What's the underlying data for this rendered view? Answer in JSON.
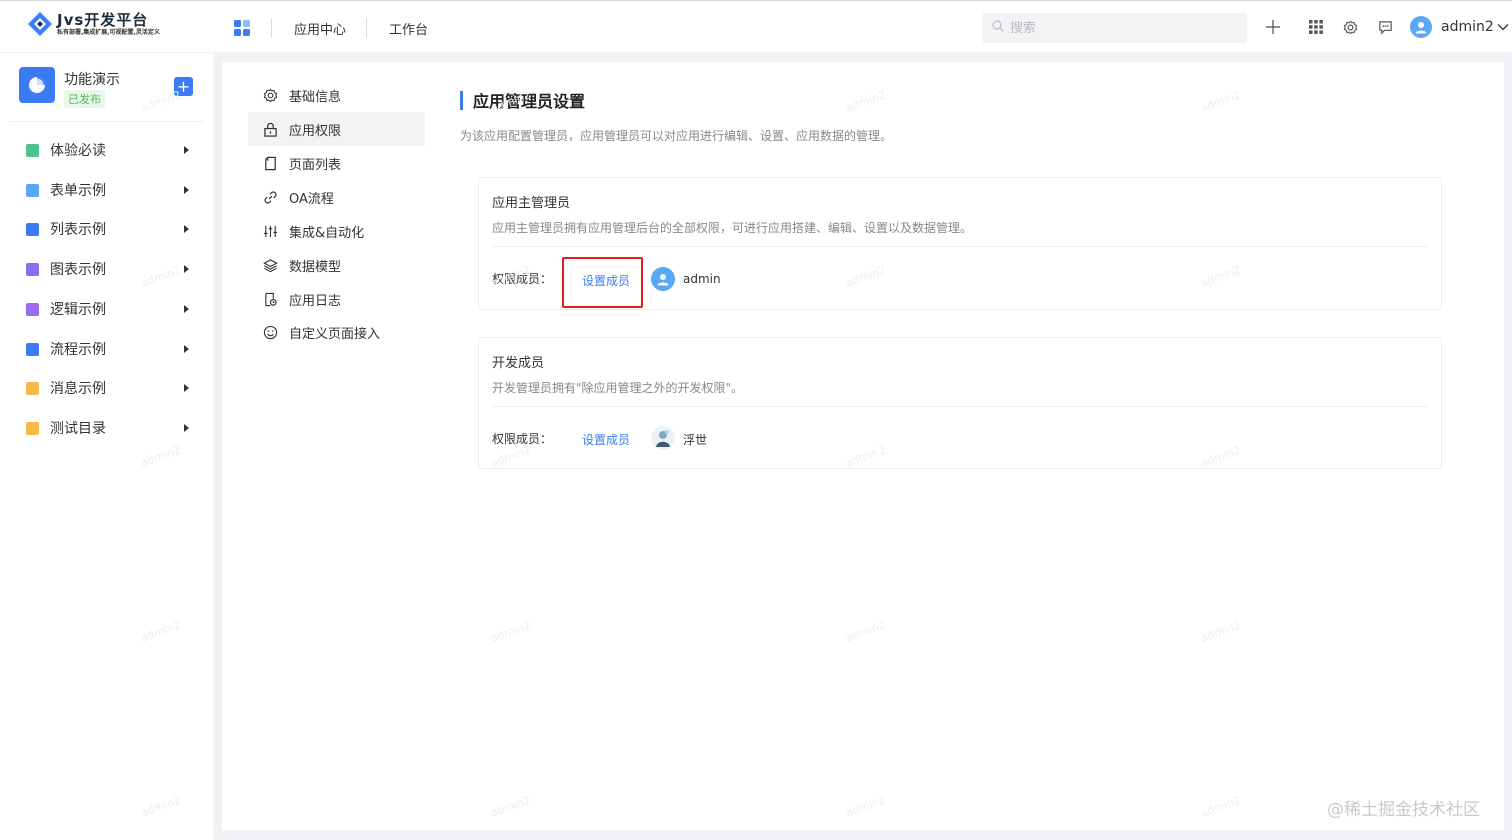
{
  "header": {
    "logo_title": "Jvs开发平台",
    "logo_subtitle": "私有部署,集成扩展,可视配置,灵活定义",
    "nav": [
      "应用中心",
      "工作台"
    ],
    "search_placeholder": "搜索",
    "username": "admin2"
  },
  "sidebar": {
    "app_name": "功能演示",
    "app_status": "已发布",
    "add_label": "+",
    "items": [
      {
        "label": "体验必读",
        "color": "#4cc38a"
      },
      {
        "label": "表单示例",
        "color": "#5aa8f5"
      },
      {
        "label": "列表示例",
        "color": "#3b7cf6"
      },
      {
        "label": "图表示例",
        "color": "#8e6cf0"
      },
      {
        "label": "逻辑示例",
        "color": "#9b6cf0"
      },
      {
        "label": "流程示例",
        "color": "#3b7cf6"
      },
      {
        "label": "消息示例",
        "color": "#f5b94a"
      },
      {
        "label": "测试目录",
        "color": "#f5b94a"
      }
    ]
  },
  "subnav": {
    "active_index": 1,
    "items": [
      {
        "label": "基础信息",
        "icon": "gear-icon"
      },
      {
        "label": "应用权限",
        "icon": "lock-icon"
      },
      {
        "label": "页面列表",
        "icon": "page-icon"
      },
      {
        "label": "OA流程",
        "icon": "link-icon"
      },
      {
        "label": "集成&自动化",
        "icon": "sliders-icon"
      },
      {
        "label": "数据模型",
        "icon": "layers-icon"
      },
      {
        "label": "应用日志",
        "icon": "log-icon"
      },
      {
        "label": "自定义页面接入",
        "icon": "smile-icon"
      }
    ]
  },
  "content": {
    "title": "应用管理员设置",
    "description": "为该应用配置管理员，应用管理员可以对应用进行编辑、设置、应用数据的管理。",
    "cards": [
      {
        "title": "应用主管理员",
        "description": "应用主管理员拥有应用管理后台的全部权限，可进行应用搭建、编辑、设置以及数据管理。",
        "member_label": "权限成员：",
        "set_label": "设置成员",
        "member_name": "admin"
      },
      {
        "title": "开发成员",
        "description": "开发管理员拥有\"除应用管理之外的开发权限\"。",
        "member_label": "权限成员：",
        "set_label": "设置成员",
        "member_name": "浮世"
      }
    ]
  },
  "watermark_text": "admin2",
  "credit": "@稀土掘金技术社区",
  "colors": {
    "accent": "#3b7cf6",
    "highlight": "#e02020",
    "published": "#5cb85c"
  }
}
